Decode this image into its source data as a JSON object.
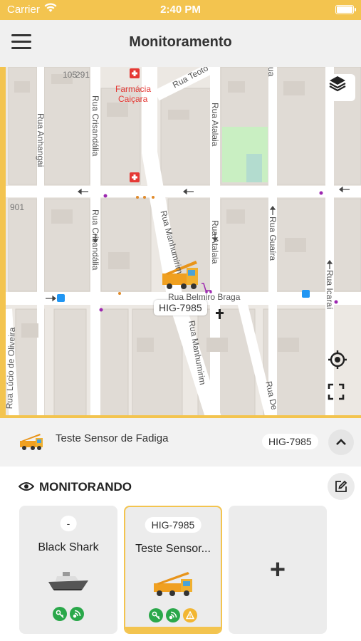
{
  "status": {
    "carrier": "Carrier",
    "time": "2:40 PM"
  },
  "header": {
    "title": "Monitoramento"
  },
  "map": {
    "vehicle_plate": "HIG-7985",
    "streets": {
      "anhangai": "Rua Anhangai",
      "crisandalia_top": "Rua Crisandália",
      "crisandalia_mid": "Rua Crisandália",
      "teotonio": "Rua Teoto",
      "atalaia_top": "Rua Atalaia",
      "atalaia_mid": "Rua Atalaia",
      "manhumirim_top": "Rua Manhumirim",
      "manhumirim_bot": "Rua Manhumirim",
      "guaira": "Rua Guaíra",
      "icarai": "Rua Icaraí",
      "belmiro": "Rua Belmiro Braga",
      "lucio": "Rua Lúcio de Oliveira",
      "de": "Rua De",
      "ua": "ua"
    },
    "pois": {
      "farmacia_1": "Farmácia",
      "farmacia_2": "Caiçara"
    },
    "numbers": {
      "n105": "105",
      "n291": "291",
      "n901": "901"
    }
  },
  "vehicle_bar": {
    "name": "Teste Sensor de Fadiga",
    "plate": "HIG-7985"
  },
  "monitor": {
    "heading": "MONITORANDO",
    "cards": [
      {
        "badge": "-",
        "name": "Black Shark"
      },
      {
        "badge": "HIG-7985",
        "name": "Teste Sensor..."
      }
    ],
    "add_label": "+"
  },
  "colors": {
    "accent": "#f3c44f",
    "green": "#2aa84a",
    "warning": "#f2b632"
  }
}
